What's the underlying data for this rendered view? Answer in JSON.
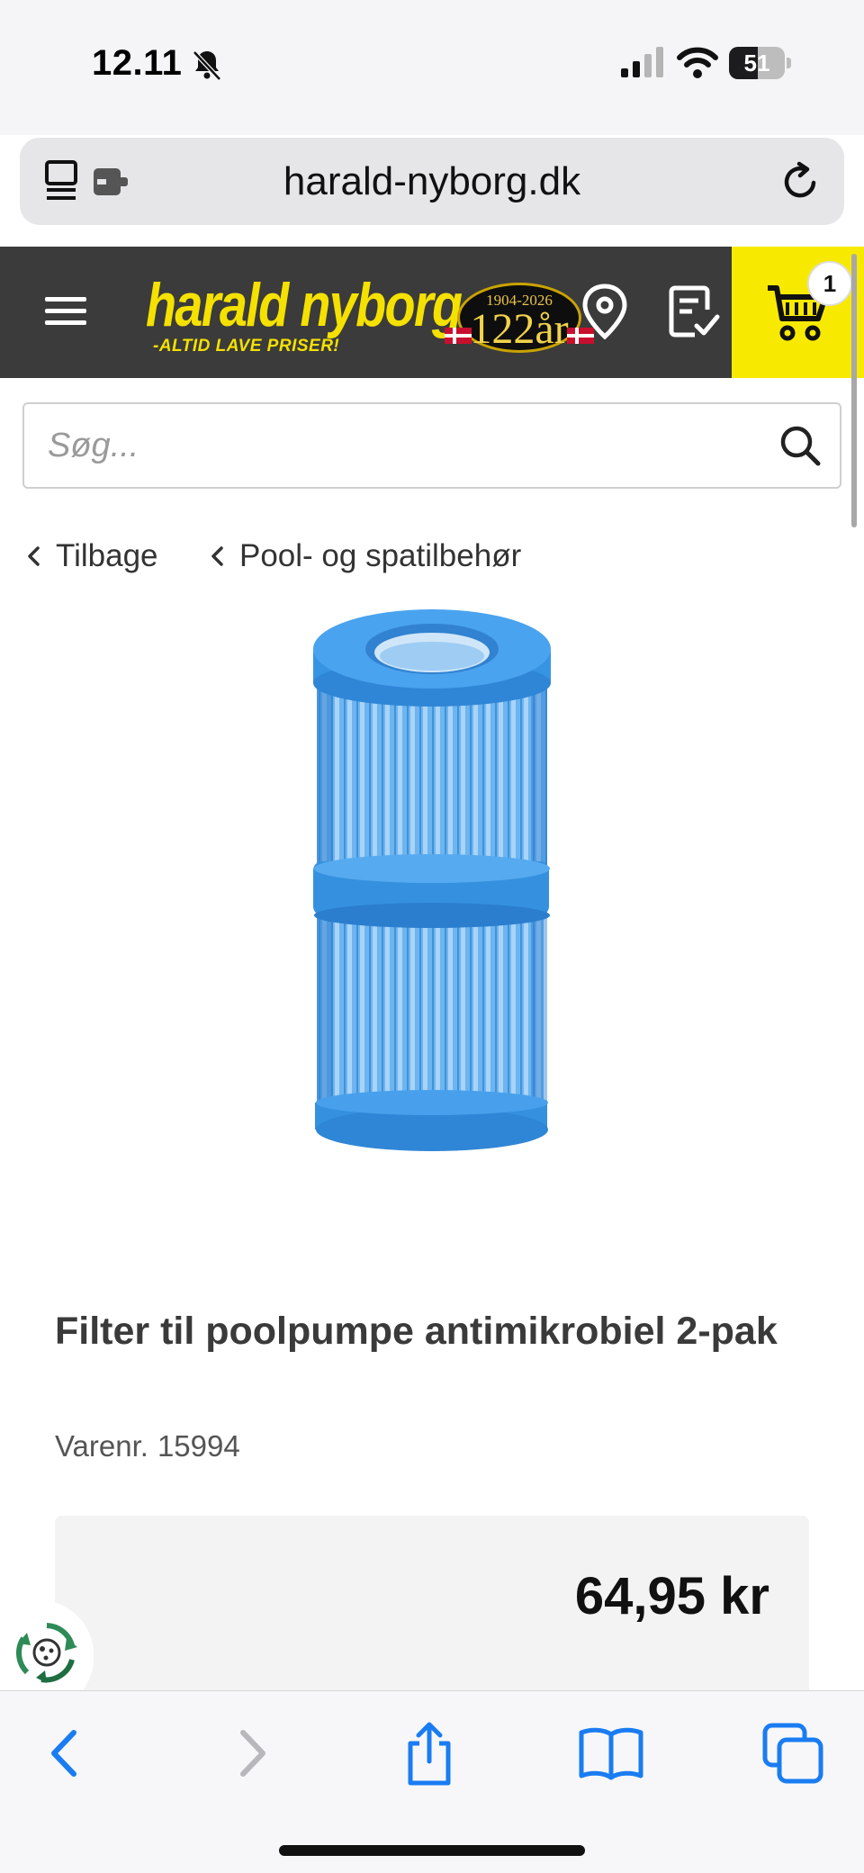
{
  "status_bar": {
    "time": "12.11",
    "battery_level": "51",
    "icons": [
      "bell-muted-icon",
      "cellular-signal-icon",
      "wifi-icon",
      "battery-icon"
    ]
  },
  "browser": {
    "url": "harald-nyborg.dk",
    "icons": [
      "tabs-icon",
      "reload-icon"
    ]
  },
  "site_header": {
    "logo_text": "harald nyborg",
    "logo_tagline": "-ALTID LAVE PRISER!",
    "anniversary_years": "1904-2026",
    "anniversary_number": "122år",
    "cart_count": "1",
    "colors": {
      "header_bg": "#3b3b3b",
      "brand_yellow": "#f5e100"
    },
    "icons": [
      "menu-icon",
      "location-pin-icon",
      "shopping-list-icon",
      "cart-icon"
    ]
  },
  "search": {
    "placeholder": "Søg..."
  },
  "breadcrumb": {
    "back_label": "Tilbage",
    "category_label": "Pool- og spatilbehør"
  },
  "product": {
    "title": "Filter til poolpumpe antimikrobiel 2-pak",
    "sku_label": "Varenr.",
    "sku": "15994",
    "price": "64,95 kr",
    "image_description_color": "#3a9be6"
  },
  "bottom_toolbar": {
    "icons": [
      "back-icon",
      "forward-icon",
      "share-icon",
      "bookmarks-icon",
      "tabs-overview-icon"
    ],
    "accent": "#1a7cf2"
  }
}
